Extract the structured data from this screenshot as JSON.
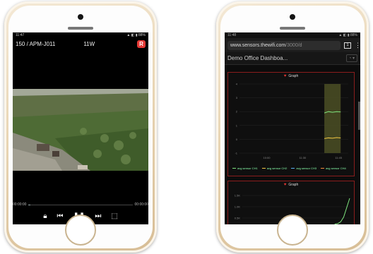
{
  "left_phone": {
    "status": {
      "time": "11:47",
      "icons": "▲ ◧ ▮ 88%"
    },
    "video_title": "150 / APM-J011",
    "rate": "11W",
    "record_badge": "R",
    "time_elapsed": "00:00:00",
    "time_total": "00:00:00",
    "progress": 0.02
  },
  "right_phone": {
    "status": {
      "time": "11:48",
      "icons": "▲ ◧ ▮ 88%"
    },
    "url": {
      "main": "www.sensors.thewifi.com",
      "path": "/3000/d"
    },
    "dashboard_title": "Demo Office Dashboa...",
    "button_label": "",
    "panel1": {
      "title": "Graph",
      "legend": [
        {
          "label": "avg sensor CH1",
          "color": "#7ee37e"
        },
        {
          "label": "avg sensor CH2",
          "color": "#f2c744"
        },
        {
          "label": "avg sensor CH3",
          "color": "#5ab0f0"
        },
        {
          "label": "avg sensor CH4",
          "color": "#f28b3c"
        }
      ]
    },
    "panel2": {
      "title": "Graph"
    }
  },
  "chart_data": [
    {
      "type": "line",
      "title": "Graph",
      "y_ticks": [
        "4",
        "3",
        "2",
        "1",
        "0",
        "-1"
      ],
      "x_ticks": [
        "10:00",
        "11:30",
        "11:45"
      ],
      "highlight_region": [
        0.78,
        0.93
      ],
      "series": [
        {
          "name": "avg sensor CH1",
          "values": [
            1.9,
            2.0,
            1.95,
            2.0,
            1.98
          ]
        },
        {
          "name": "avg sensor CH2",
          "values": [
            0.05,
            0.1,
            0.08,
            0.12,
            0.1
          ]
        }
      ]
    },
    {
      "type": "line",
      "title": "Graph",
      "y_ticks": [
        "1.5K",
        "1.0K",
        "0.5K"
      ],
      "series": [
        {
          "values": [
            0.1,
            0.12,
            0.2,
            0.4,
            0.8,
            1.2
          ]
        }
      ]
    }
  ],
  "colors": {
    "frame": "#e9d6b5",
    "accent_red": "#e53935",
    "panel_border": "#8a1d1d",
    "highlight": "#4b4f25"
  }
}
